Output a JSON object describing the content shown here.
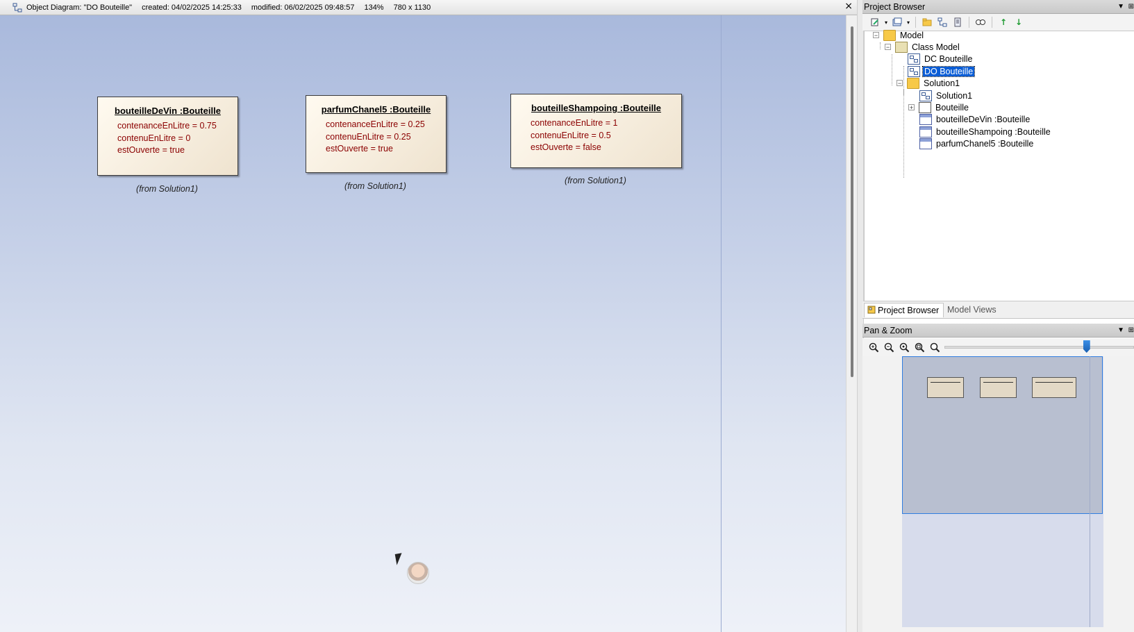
{
  "diagram_window": {
    "segments": [
      "Object Diagram:  \"DO Bouteille\"",
      "created: 04/02/2025 14:25:33",
      "modified: 06/02/2025 09:48:57",
      "134%",
      "780 x 1130"
    ],
    "close_symbol": "×"
  },
  "objects": [
    {
      "title": "bouteilleDeVin :Bouteille",
      "attributes": [
        "contenanceEnLitre = 0.75",
        "contenuEnLitre = 0",
        "estOuverte = true"
      ],
      "from": "(from Solution1)"
    },
    {
      "title": "parfumChanel5 :Bouteille",
      "attributes": [
        "contenanceEnLitre = 0.25",
        "contenuEnLitre = 0.25",
        "estOuverte = true"
      ],
      "from": "(from Solution1)"
    },
    {
      "title": "bouteilleShampoing :Bouteille",
      "attributes": [
        "contenanceEnLitre = 1",
        "contenuEnLitre = 0.5",
        "estOuverte = false"
      ],
      "from": "(from Solution1)"
    }
  ],
  "project_browser": {
    "title": "Project Browser",
    "header_buttons": [
      "▼",
      "⊞"
    ],
    "tree": {
      "model": "Model",
      "class_model": "Class Model",
      "dc_bouteille": "DC Bouteille",
      "do_bouteille": "DO Bouteille",
      "solution1_pkg": "Solution1",
      "solution1_diagram": "Solution1",
      "bouteille_class": "Bouteille",
      "obj1": "bouteilleDeVin :Bouteille",
      "obj2": "bouteilleShampoing :Bouteille",
      "obj3": "parfumChanel5 :Bouteille"
    },
    "tabs": [
      "Project Browser",
      "Model Views"
    ]
  },
  "pan_zoom": {
    "title": "Pan & Zoom",
    "header_buttons": [
      "▼",
      "⊞"
    ],
    "zoom_buttons": [
      "zoom-in-icon",
      "zoom-out-icon",
      "zoom-100-icon",
      "zoom-fit-icon",
      "zoom-page-icon"
    ],
    "zoom_slider_fraction": 0.75
  },
  "colors": {
    "attribute": "#8b0000",
    "selection": "#0a5dd6",
    "canvas_top": "#a9b9dc",
    "canvas_bottom": "#eef1f8"
  }
}
